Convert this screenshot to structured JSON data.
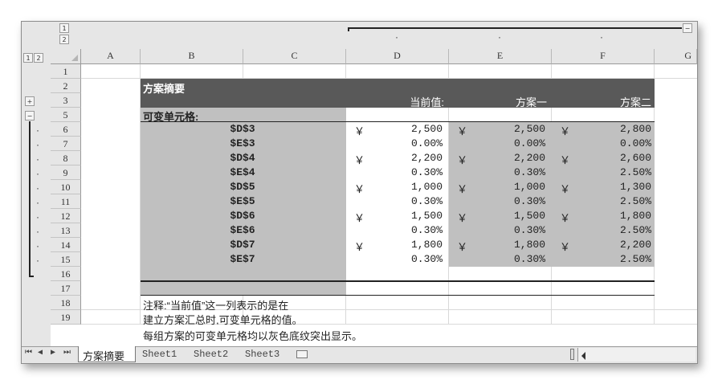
{
  "outline": {
    "col_levels": [
      "1",
      "2"
    ],
    "row_levels": [
      "1",
      "2"
    ],
    "collapse_col_symbol": "−",
    "expand_row_symbol": "+",
    "collapse_row_symbol": "−"
  },
  "columns": [
    "A",
    "B",
    "C",
    "D",
    "E",
    "F",
    "G"
  ],
  "rows": [
    "1",
    "2",
    "3",
    "5",
    "6",
    "7",
    "8",
    "9",
    "10",
    "11",
    "12",
    "13",
    "14",
    "15",
    "16",
    "17",
    "18",
    "19"
  ],
  "report": {
    "title": "方案摘要",
    "header_current": "当前值:",
    "header_s1": "方案一",
    "header_s2": "方案二",
    "changing_label": "可变单元格:",
    "currency": "￥",
    "items": [
      {
        "cell": "$D$3",
        "current": "2,500",
        "s1": "2,500",
        "s2": "2,800",
        "money": true
      },
      {
        "cell": "$E$3",
        "current": "0.00%",
        "s1": "0.00%",
        "s2": "0.00%",
        "money": false
      },
      {
        "cell": "$D$4",
        "current": "2,200",
        "s1": "2,200",
        "s2": "2,600",
        "money": true
      },
      {
        "cell": "$E$4",
        "current": "0.30%",
        "s1": "0.30%",
        "s2": "2.50%",
        "money": false
      },
      {
        "cell": "$D$5",
        "current": "1,000",
        "s1": "1,000",
        "s2": "1,300",
        "money": true
      },
      {
        "cell": "$E$5",
        "current": "0.30%",
        "s1": "0.30%",
        "s2": "2.50%",
        "money": false
      },
      {
        "cell": "$D$6",
        "current": "1,500",
        "s1": "1,500",
        "s2": "1,800",
        "money": true
      },
      {
        "cell": "$E$6",
        "current": "0.30%",
        "s1": "0.30%",
        "s2": "2.50%",
        "money": false
      },
      {
        "cell": "$D$7",
        "current": "1,800",
        "s1": "1,800",
        "s2": "2,200",
        "money": true
      },
      {
        "cell": "$E$7",
        "current": "0.30%",
        "s1": "0.30%",
        "s2": "2.50%",
        "money": false
      }
    ],
    "notes": [
      "注释:“当前值”这一列表示的是在",
      "建立方案汇总时,可变单元格的值。",
      "每组方案的可变单元格均以灰色底纹突出显示。"
    ]
  },
  "tabs": [
    "方案摘要",
    "Sheet1",
    "Sheet2",
    "Sheet3"
  ],
  "nav_buttons": [
    "⏮",
    "◀",
    "▶",
    "⏭"
  ],
  "colors": {
    "title_bg": "#595959",
    "highlight_bg": "#c0c0c0",
    "header_bg": "#e6e6e6"
  }
}
